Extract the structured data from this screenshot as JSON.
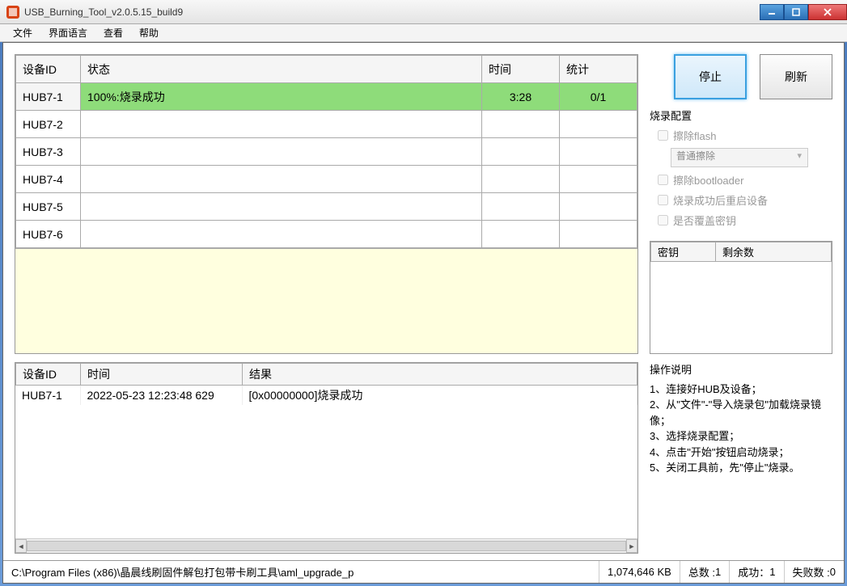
{
  "window": {
    "title": "USB_Burning_Tool_v2.0.5.15_build9"
  },
  "menu": {
    "file": "文件",
    "language": "界面语言",
    "view": "查看",
    "help": "帮助"
  },
  "devtable": {
    "headers": {
      "id": "设备ID",
      "status": "状态",
      "time": "时间",
      "stat": "统计"
    },
    "rows": [
      {
        "id": "HUB7-1",
        "status": "100%:烧录成功",
        "time": "3:28",
        "stat": "0/1",
        "success": true
      },
      {
        "id": "HUB7-2",
        "status": "",
        "time": "",
        "stat": "",
        "success": false
      },
      {
        "id": "HUB7-3",
        "status": "",
        "time": "",
        "stat": "",
        "success": false
      },
      {
        "id": "HUB7-4",
        "status": "",
        "time": "",
        "stat": "",
        "success": false
      },
      {
        "id": "HUB7-5",
        "status": "",
        "time": "",
        "stat": "",
        "success": false
      },
      {
        "id": "HUB7-6",
        "status": "",
        "time": "",
        "stat": "",
        "success": false
      }
    ]
  },
  "logtable": {
    "headers": {
      "id": "设备ID",
      "time": "时间",
      "result": "结果"
    },
    "rows": [
      {
        "id": "HUB7-1",
        "time": "2022-05-23 12:23:48 629",
        "result": "[0x00000000]烧录成功"
      }
    ]
  },
  "buttons": {
    "stop": "停止",
    "refresh": "刷新"
  },
  "config": {
    "title": "烧录配置",
    "erase_flash": "擦除flash",
    "erase_mode": "普通擦除",
    "erase_bootloader": "擦除bootloader",
    "reboot": "烧录成功后重启设备",
    "override_key": "是否覆盖密钥"
  },
  "keytable": {
    "headers": {
      "key": "密钥",
      "remain": "剩余数"
    }
  },
  "instructions": {
    "title": "操作说明",
    "line1": "1、连接好HUB及设备；",
    "line2": "2、从\"文件\"-\"导入烧录包\"加载烧录镜像；",
    "line3": "3、选择烧录配置；",
    "line4": "4、点击\"开始\"按钮启动烧录；",
    "line5": "5、关闭工具前，先\"停止\"烧录。"
  },
  "status": {
    "path": "C:\\Program Files (x86)\\晶晨线刷固件解包打包带卡刷工具\\aml_upgrade_p",
    "size": "1,074,646 KB",
    "total_label": "总数 :",
    "total_val": "1",
    "success_label": "成功：",
    "success_val": "1",
    "fail_label": "失败数 :",
    "fail_val": "0"
  }
}
